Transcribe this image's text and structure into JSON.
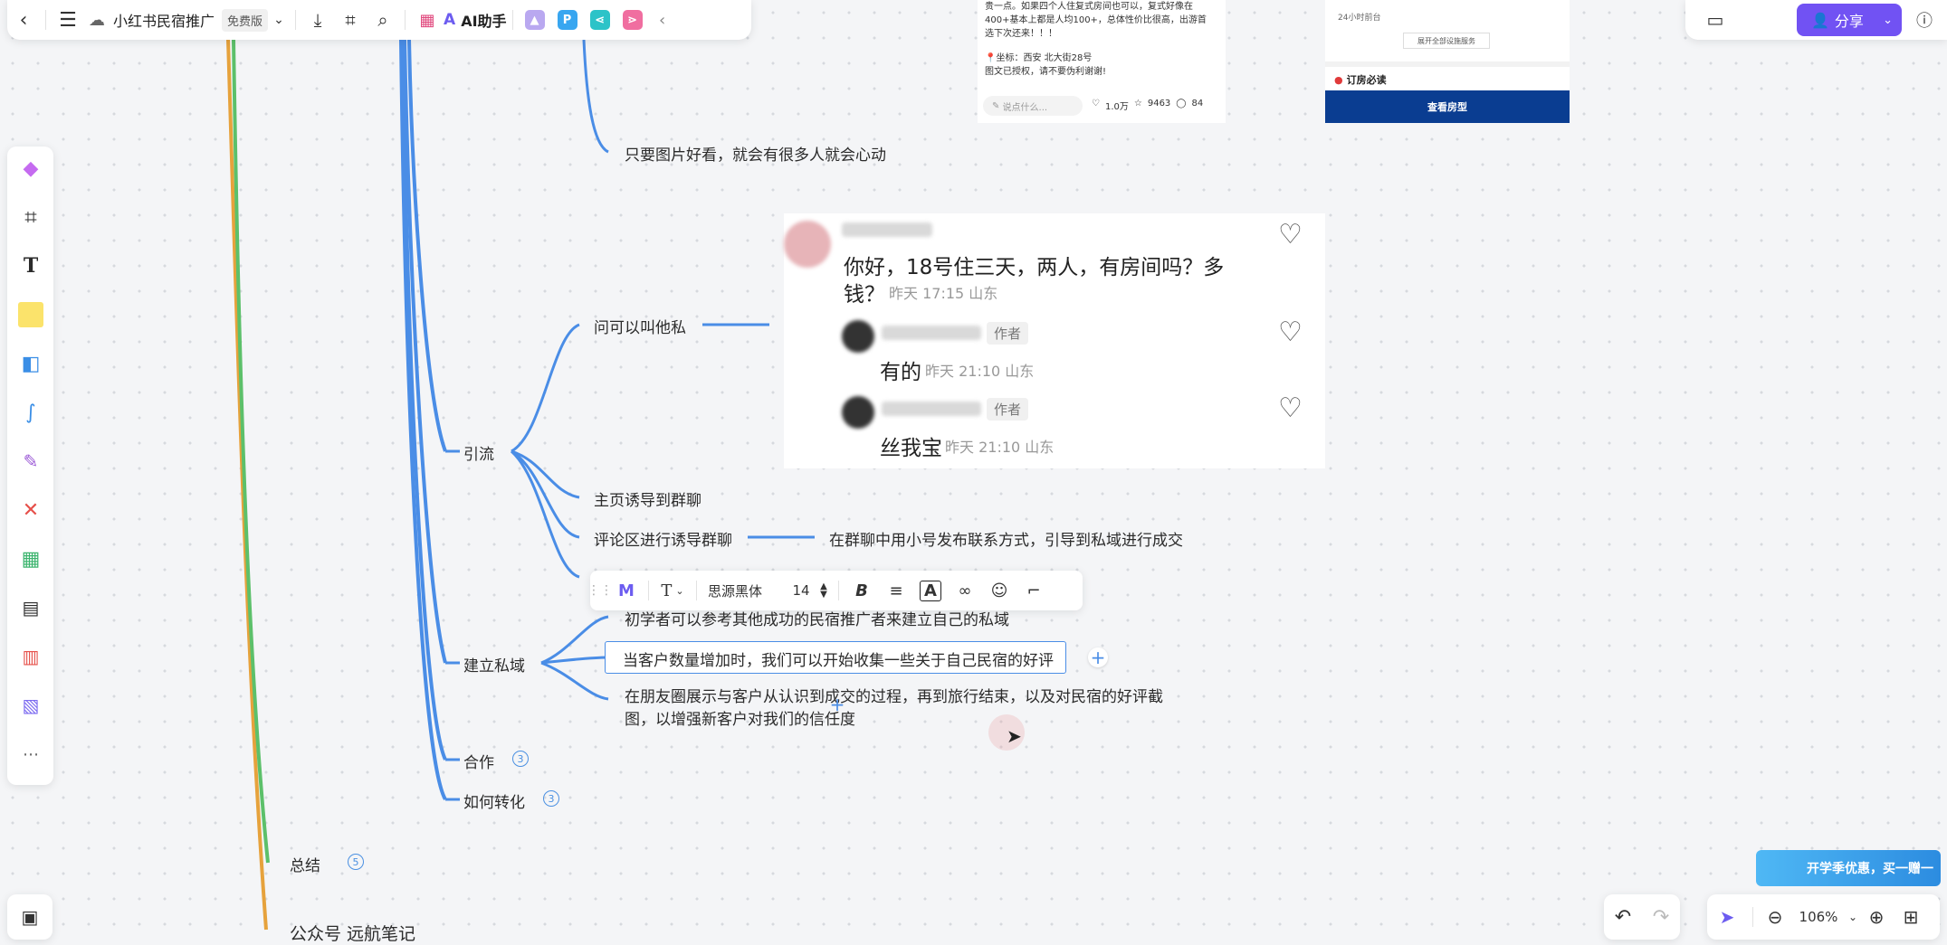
{
  "topbar": {
    "title": "小红书民宿推广",
    "plan_badge": "免费版",
    "ai_label": "AI助手"
  },
  "topright": {
    "share_label": "分享"
  },
  "mindmap": {
    "node_tip": "只要图片好看，就会有很多人就会心动",
    "node_yinliu": "引流",
    "node_ask": "问可以叫他私",
    "node_homepage": "主页诱导到群聊",
    "node_comment": "评论区进行诱导群聊",
    "node_comment_detail": "在群聊中用小号发布联系方式，引导到私域进行成交",
    "node_private": "建立私域",
    "node_private_1": "初学者可以参考其他成功的民宿推广者来建立自己的私域",
    "node_private_2": "当客户数量增加时，我们可以开始收集一些关于自己民宿的好评",
    "node_private_3": "在朋友圈展示与客户从认识到成交的过程，再到旅行结束，以及对民宿的好评截图，以增强新客户对我们的信任度",
    "node_coop": "合作",
    "node_coop_count": "3",
    "node_convert": "如何转化",
    "node_convert_count": "3",
    "node_summary": "总结",
    "node_summary_count": "5",
    "node_wechat": "公众号 远航笔记"
  },
  "comment_card": {
    "c1_text": "你好，18号住三天，两人，有房间吗？多",
    "c1_text2": "钱？",
    "c1_meta": "昨天 17:15 山东",
    "author_tag": "作者",
    "r1_text": "有的",
    "r1_meta": "昨天 21:10 山东",
    "r2_text": "丝我宝",
    "r2_meta": "昨天 21:10 山东"
  },
  "shot1": {
    "line1": "贵一点。如果四个人住复式房间也可以，复式好像在",
    "line2": "400+基本上都是人均100+，总体性价比很高，出游首",
    "line3": "选下次还来！！！",
    "location": "📍坐标：西安 北大街28号",
    "rights": "图文已授权，请不要伪利谢谢!",
    "input_placeholder": "说点什么...",
    "likes": "1.0万",
    "stars": "9463",
    "comments": "84"
  },
  "shot2": {
    "line1": "24小时前台",
    "button_small": "展开全部设施服务",
    "notice": "订房必读",
    "button_big": "查看房型"
  },
  "fmtbar": {
    "font": "思源黑体",
    "size": "14"
  },
  "zoom": {
    "level": "106%"
  },
  "promo": {
    "text": "开学季优惠，买一赠一"
  },
  "colors": {
    "blue_branch": "#4a8de6",
    "orange_branch": "#e6a23c",
    "green_branch": "#5cc06a",
    "accent": "#7152f3"
  }
}
